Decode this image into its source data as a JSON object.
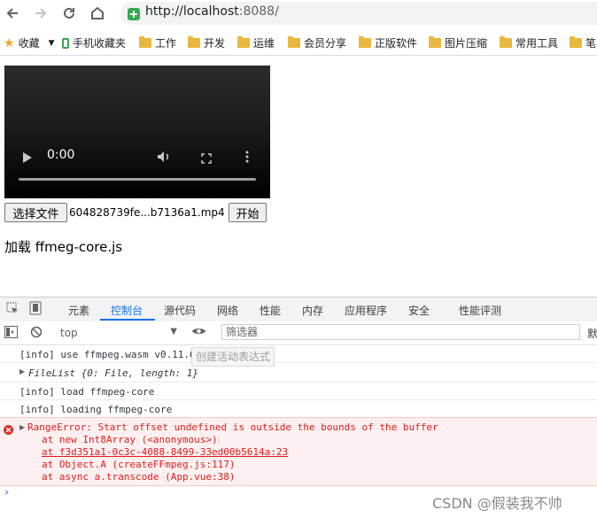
{
  "browser": {
    "url_host": "http://localhost",
    "url_port": ":8088/"
  },
  "bookmarks": [
    {
      "label": "收藏",
      "icon": "star-icon"
    },
    {
      "label": "手机收藏夹",
      "icon": "phone-icon"
    },
    {
      "label": "工作",
      "icon": "folder-icon"
    },
    {
      "label": "开发",
      "icon": "folder-icon"
    },
    {
      "label": "运维",
      "icon": "folder-icon"
    },
    {
      "label": "会员分享",
      "icon": "folder-icon"
    },
    {
      "label": "正版软件",
      "icon": "folder-icon"
    },
    {
      "label": "图片压缩",
      "icon": "folder-icon"
    },
    {
      "label": "常用工具",
      "icon": "folder-icon"
    },
    {
      "label": "笔",
      "icon": "folder-icon"
    }
  ],
  "page": {
    "video_time": "0:00",
    "choose_file_label": "选择文件",
    "file_name": "604828739fe...b7136a1.mp4",
    "start_label": "开始",
    "status_text": "加载 ffmeg-core.js"
  },
  "devtools": {
    "tabs": [
      "元素",
      "控制台",
      "源代码",
      "网络",
      "性能",
      "内存",
      "应用程序",
      "安全",
      "性能评测"
    ],
    "active_tab": "控制台",
    "context": "top",
    "filter_placeholder": "筛选器",
    "right_cut": "默",
    "tooltip": "创建活动表达式",
    "logs": [
      "[info] use ffmpeg.wasm v0.11.6",
      "FileList {0: File, length: 1}",
      "[info] load ffmpeg-core",
      "[info] loading ffmpeg-core"
    ],
    "error": {
      "message": "RangeError: Start offset undefined is outside the bounds of the buffer",
      "stack": [
        "at new Int8Array (<anonymous>)",
        "at f3d351a1-0c3c-4088-8499-33ed00b5614a:23",
        "at Object.A (createFFmpeg.js:117)",
        "at async a.transcode (App.vue:38)"
      ]
    },
    "prompt": "›"
  },
  "watermark": "CSDN @假装我不帅"
}
